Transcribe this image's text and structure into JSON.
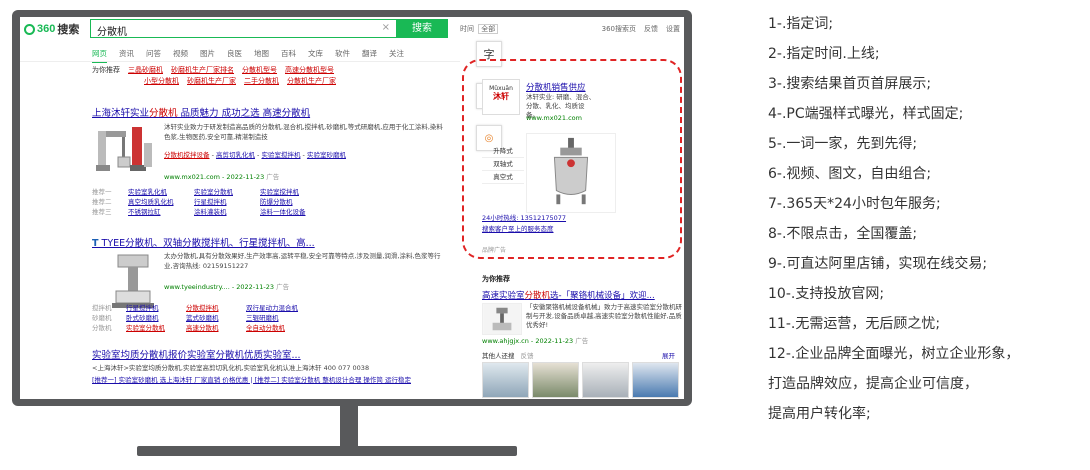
{
  "search": {
    "query": "分散机",
    "clear_symbol": "×",
    "button_label": "搜索",
    "time_label": "时间",
    "time_value": "全部",
    "header_links": [
      "360搜索页",
      "反馈",
      "设置"
    ],
    "tabs": [
      "网页",
      "资讯",
      "问答",
      "视频",
      "图片",
      "良医",
      "地图",
      "百科",
      "文库",
      "软件",
      "翻译",
      "关注"
    ]
  },
  "recommend": {
    "label": "为你推荐",
    "links_row1": [
      "三晶砂磨机",
      "砂磨机生产厂家排名",
      "分散机型号",
      "高速分散机型号"
    ],
    "links_row2": [
      "小型分散机",
      "砂磨机生产厂家",
      "二手分散机",
      "分散机生产厂家"
    ]
  },
  "result1": {
    "title_prefix": "上海沐轩实业",
    "title_hl": "分散机",
    "title_suffix": " 品质魅力 成功之选 高速分散机",
    "desc": "沐轩实业致力于研发制造高品质的分散机,混合机,搅拌机,砂磨机,等式研磨机,应用于化工涂料,染料色浆,生物医药,安全可靠,精湛制造技",
    "links": [
      "分散机搅拌设备",
      "高剪切乳化机",
      "实验室搅拌机",
      "实验室砂磨机"
    ],
    "url": "www.mx021.com - 2022-11-23",
    "ad_tag": "广告",
    "sub_headers": [
      "推荐一",
      "推荐二",
      "推荐三"
    ],
    "sub_rows": [
      [
        "实验室乳化机",
        "实验室分散机",
        "实验室搅拌机"
      ],
      [
        "真空均质乳化机",
        "行星搅拌机",
        "防爆分散机"
      ],
      [
        "不锈钢拉缸",
        "涂料灌装机",
        "涂料一体化设备"
      ]
    ]
  },
  "result2": {
    "title_icon": "T",
    "title": "TYEE分散机、双轴分散搅拌机、行星搅拌机、高...",
    "desc": "太办分散机,具有分散效果好,生产效率高,运转平稳,安全可靠等特点,涉及测量,润滑,涂料,色浆等行业,咨询热线: 02159151227",
    "url": "www.tyeeindustry.... - 2022-11-23",
    "ad_tag": "广告",
    "sub_headers": [
      "搅拌机",
      "砂磨机",
      "分散机"
    ],
    "sub_rows": [
      [
        "行星搅拌机",
        "分散搅拌机",
        "双行星动力混合机"
      ],
      [
        "卧式砂磨机",
        "篮式砂磨机",
        "三辊研磨机"
      ],
      [
        "实验室分散机",
        "高速分散机",
        "全自动分散机"
      ]
    ]
  },
  "result3": {
    "title": "实验室均质分散机报价实验室分散机优质实验室...",
    "desc": "<上海沐轩>实验室均质分散机,实验室高剪切乳化机,实验室乳化机认准上海沐轩 400 077 0038",
    "links": "[推荐一] 实验室砂磨机 选上海沐轩 厂家直销 价格优惠 | [推荐二] 实验室分散机 整机设计合理 操作简 运行稳定",
    "more": "2022-11-23"
  },
  "side_icons": [
    "字"
  ],
  "brand_ad": {
    "logo_top": "Mǔxuān",
    "logo_cn": "沐轩",
    "title": "分散机销售供应",
    "desc": "沐轩实业: 研磨、混合、分散、乳化、均质设备。",
    "url": "www.mx021.com",
    "categories": [
      "升降式",
      "双轴式",
      "真空式"
    ],
    "hotline": "24小时热线: 13512175077",
    "guide": "搜索客户至上的服务态度",
    "tag": "品牌广告"
  },
  "recommend_right": {
    "label": "为你推荐",
    "title_prefix": "高速实验室",
    "title_hl": "分散机",
    "title_suffix": "选-「聚铬机械设备」欢迎...",
    "desc": "「安徽聚铬机械设备机械」致力于高速实验室分散机研制与开发,设备品质卓越,高速实验室分散机性能好,品质优秀好!",
    "url": "www.ahjgjx.cn - 2022-11-23",
    "ad_tag": "广告",
    "others_label": "其他人还搜",
    "feedback": "反馈",
    "expand": "展开"
  },
  "features": [
    "1-.指定词;",
    "2-.指定时间.上线;",
    "3-.搜索结果首页首屏展示;",
    "4-.PC端强样式曝光，样式固定;",
    "5-.一词一家，先到先得;",
    "6-.视频、图文，自由组合;",
    "7-.365天*24小时包年服务;",
    "8-.不限点击，全国覆盖;",
    "9-.可直达阿里店铺，实现在线交易;",
    "10-.支持投放官网;",
    "11-.无需运营，无后顾之忧;",
    "12-.企业品牌全面曝光，树立企业形象，",
    "打造品牌效应，提高企业可信度，",
    "提高用户转化率;"
  ],
  "colors": {
    "brand_green": "#19b955",
    "monitor": "#58595b",
    "dash_red": "#e02424",
    "link_blue": "#1a0dab",
    "highlight_red": "#cc0000"
  }
}
